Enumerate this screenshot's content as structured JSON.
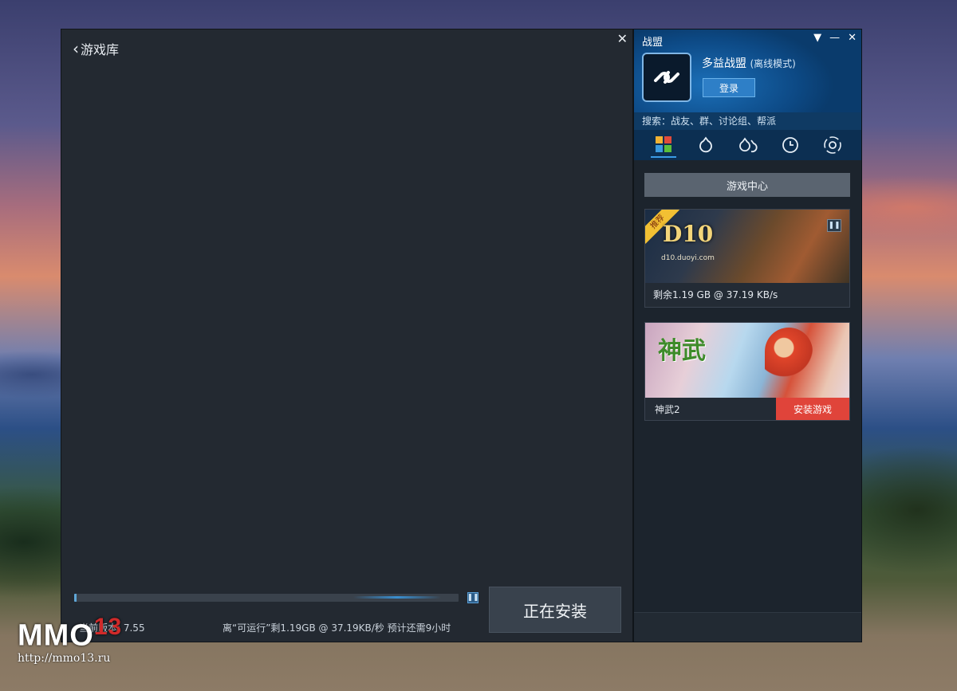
{
  "window": {
    "back_label": "游戏库",
    "close_glyph": "✕",
    "progress_fraction": 0.003,
    "install_status_label": "正在安装",
    "status_left": "当前版本: 7.55",
    "status_mid": "离“可运行”剩1.19GB @ 37.19KB/秒 预计还需9小时"
  },
  "side": {
    "title": "战盟",
    "controls": [
      "▼",
      "—",
      "✕"
    ],
    "profile": {
      "name": "多益战盟",
      "mode": "(离线模式)",
      "login_label": "登录"
    },
    "search_placeholder": "搜索：战友、群、讨论组、帮派",
    "tabs": [
      "games-icon",
      "contacts-icon",
      "groups-icon",
      "history-icon",
      "spiral-icon"
    ],
    "game_center_label": "游戏中心",
    "cards": [
      {
        "tag": "推荐",
        "logo": "D10",
        "url": "d10.duoyi.com",
        "status": "剩余1.19 GB @ 37.19 KB/s"
      },
      {
        "logo": "神武",
        "name": "神武2",
        "action": "安装游戏"
      }
    ]
  },
  "watermark": {
    "brand": "MMO",
    "number": "13",
    "url": "http://mmo13.ru"
  },
  "colors": {
    "accent": "#2e7fc7",
    "danger": "#e0443a",
    "window_bg": "#232931"
  }
}
